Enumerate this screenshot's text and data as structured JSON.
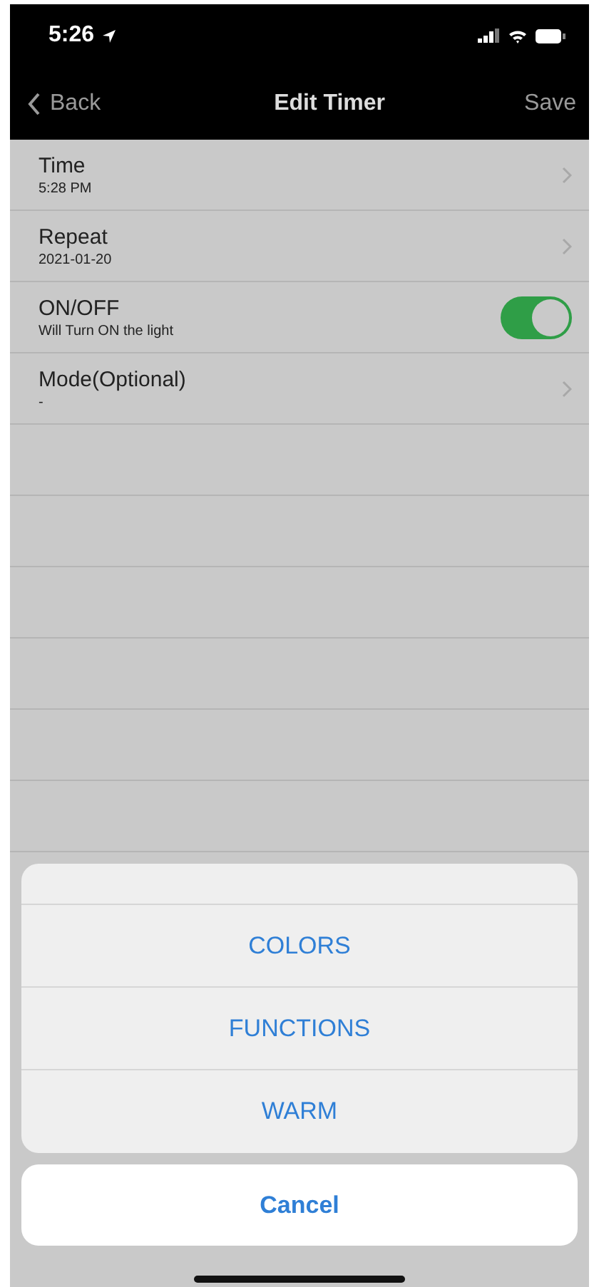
{
  "status_bar": {
    "time": "5:26"
  },
  "nav": {
    "back": "Back",
    "title": "Edit Timer",
    "action": "Save"
  },
  "rows": [
    {
      "kind": "link",
      "title": "Time",
      "subtitle": "5:28 PM"
    },
    {
      "kind": "link",
      "title": "Repeat",
      "subtitle": "2021-01-20"
    },
    {
      "kind": "toggle",
      "title": "ON/OFF",
      "subtitle": "Will Turn ON the light",
      "on": true
    },
    {
      "kind": "link",
      "title": "Mode(Optional)",
      "subtitle": "-"
    }
  ],
  "action_sheet": {
    "options": [
      "COLORS",
      "FUNCTIONS",
      "WARM"
    ],
    "cancel": "Cancel"
  }
}
